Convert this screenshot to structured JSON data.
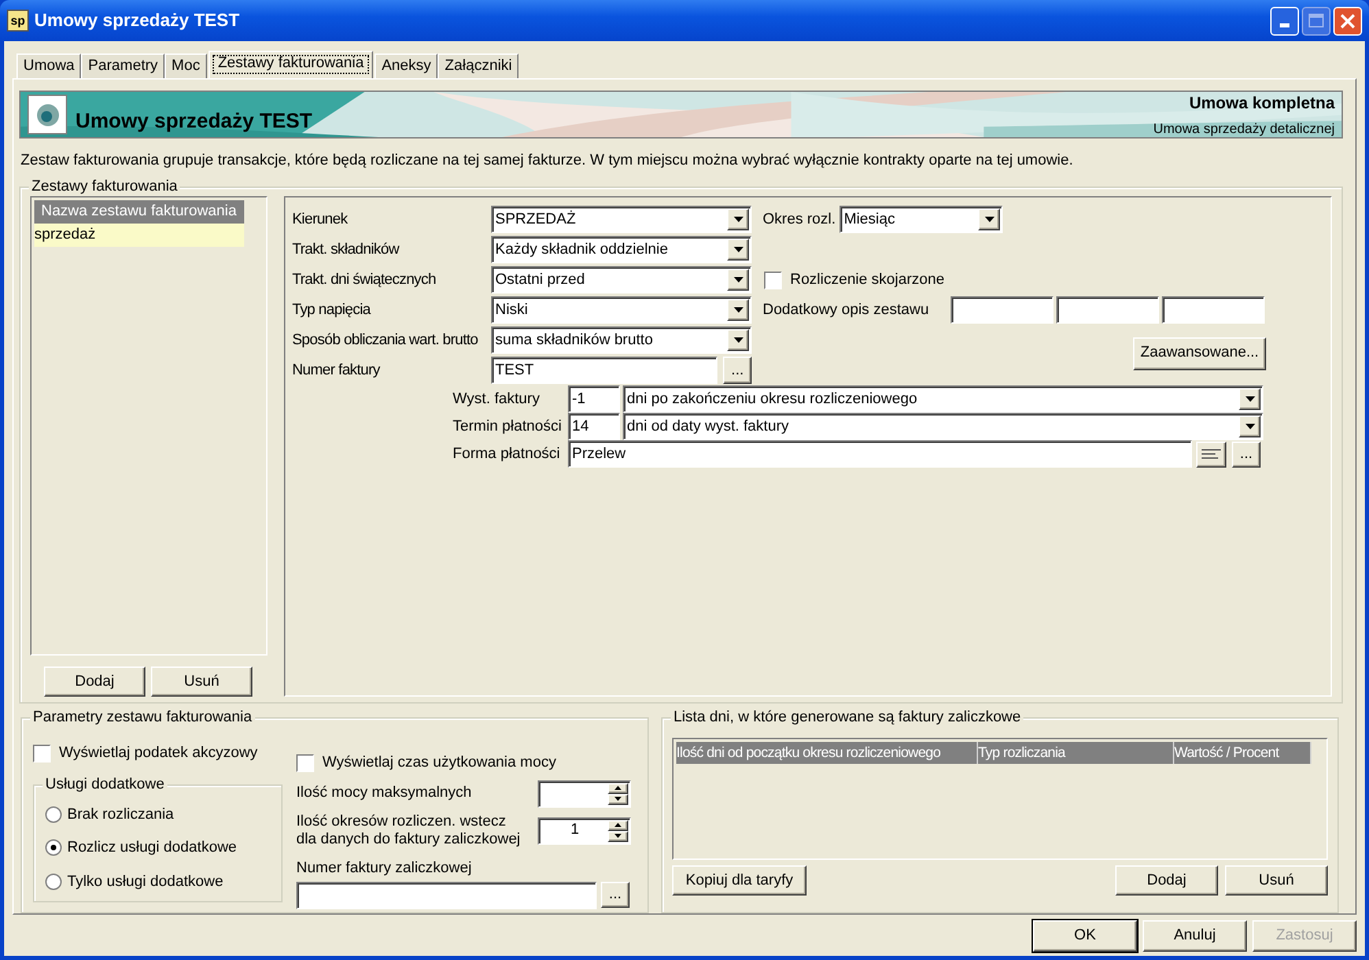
{
  "window": {
    "icon_text": "sp",
    "title": "Umowy sprzedaży TEST"
  },
  "tabs": [
    {
      "label": "Umowa",
      "selected": false
    },
    {
      "label": "Parametry",
      "selected": false
    },
    {
      "label": "Moc",
      "selected": false
    },
    {
      "label": "Zestawy fakturowania",
      "selected": true
    },
    {
      "label": "Aneksy",
      "selected": false
    },
    {
      "label": "Załączniki",
      "selected": false
    }
  ],
  "banner": {
    "title": "Umowy sprzedaży TEST",
    "status": "Umowa kompletna",
    "subtitle": "Umowa sprzedaży detalicznej"
  },
  "description": "Zestaw fakturowania grupuje transakcje, które będą rozliczane na tej samej fakturze. W tym miejscu można wybrać wyłącznie kontrakty oparte na tej umowie.",
  "billing_sets": {
    "title": "Zestawy fakturowania",
    "column": "Nazwa zestawu fakturowania",
    "items": [
      {
        "name": "sprzedaż",
        "selected": true
      }
    ],
    "buttons": [
      "Dodaj",
      "Usuń"
    ]
  },
  "form": {
    "rows": [
      {
        "label": "Kierunek",
        "kind": "select",
        "value": "SPRZEDAŻ",
        "side": {
          "kind": "select",
          "label": "Okres rozl.",
          "value": "Miesiąc"
        }
      },
      {
        "label": "Trakt. składników",
        "kind": "select",
        "value": "Każdy składnik oddzielnie"
      },
      {
        "label": "Trakt. dni świątecznych",
        "kind": "select",
        "value": "Ostatni przed",
        "side": {
          "kind": "checkbox",
          "label": "Rozliczenie skojarzone",
          "checked": false
        }
      },
      {
        "label": "Typ napięcia",
        "kind": "select",
        "value": "Niski",
        "side": {
          "kind": "inputs",
          "label": "Dodatkowy opis zestawu"
        }
      },
      {
        "label": "Sposób obliczania wart. brutto",
        "kind": "select",
        "value": "suma składników brutto"
      },
      {
        "label": "Numer faktury",
        "kind": "browse",
        "value": "TEST",
        "button": "...",
        "side": {
          "kind": "button",
          "label": "Zaawansowane..."
        }
      }
    ],
    "sub_rows": [
      {
        "label": "Wyst. faktury",
        "kind": "select",
        "number": "-1",
        "value": "dni po zakończeniu okresu rozliczeniowego"
      },
      {
        "label": "Termin płatności",
        "kind": "select",
        "number": "14",
        "value": "dni od daty wyst. faktury"
      },
      {
        "label": "Forma płatności",
        "kind": "picker",
        "value": "Przelew",
        "button": "..."
      }
    ]
  },
  "parameters": {
    "title": "Parametry zestawu fakturowania",
    "left_checkbox": {
      "label": "Wyświetlaj podatek akcyzowy",
      "checked": false
    },
    "services": {
      "title": "Usługi dodatkowe",
      "options": [
        {
          "label": "Brak rozliczania",
          "selected": false
        },
        {
          "label": "Rozlicz usługi dodatkowe",
          "selected": true
        },
        {
          "label": "Tylko usługi dodatkowe",
          "selected": false
        }
      ]
    },
    "right_checkbox": {
      "label": "Wyświetlaj czas użytkowania mocy",
      "checked": false
    },
    "spinners": [
      {
        "label": "Ilość mocy maksymalnych"
      },
      {
        "label": "Ilość okresów rozliczen. wstecz dla danych do faktury zaliczkowej",
        "value": "1"
      }
    ],
    "advance_invoice": {
      "label": "Numer faktury zaliczkowej",
      "button": "..."
    }
  },
  "advance_days": {
    "title": "Lista dni, w które generowane są faktury zaliczkowe",
    "columns": [
      "Ilość dni od początku okresu rozliczeniowego",
      "Typ rozliczania",
      "Wartość / Procent"
    ],
    "left_button": "Kopiuj dla taryfy",
    "buttons": [
      "Dodaj",
      "Usuń"
    ]
  },
  "footer": [
    {
      "label": "OK",
      "default": true,
      "disabled": false
    },
    {
      "label": "Anuluj",
      "default": false,
      "disabled": false
    },
    {
      "label": "Zastosuj",
      "default": false,
      "disabled": true
    }
  ]
}
